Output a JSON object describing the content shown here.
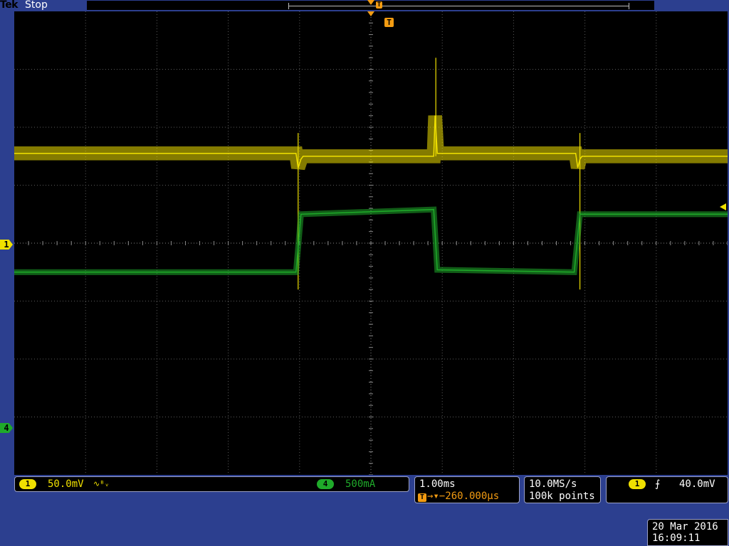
{
  "header": {
    "brand": "Tek",
    "acquisition_state": "Stop",
    "trigger_position_marker": "T"
  },
  "graticule": {
    "horizontal_divisions": 10,
    "vertical_divisions": 8,
    "grid": true
  },
  "channels": {
    "ch1": {
      "label": "1",
      "scale": "50.0mV",
      "coupling_symbol": "∿ᴮᵥ",
      "color": "#f0e000"
    },
    "ch4": {
      "label": "4",
      "scale": "500mA",
      "color": "#1faa2a"
    }
  },
  "timebase": {
    "time_per_div": "1.00ms",
    "trigger_icon": "T",
    "trigger_delay": "→▾−260.000µs"
  },
  "acquisition": {
    "sample_rate": "10.0MS/s",
    "record_length": "100k points"
  },
  "trigger": {
    "source_label": "1",
    "slope_icon": "rising-edge-icon",
    "slope_symbol": "⨍",
    "level": "40.0mV",
    "marker_color": "#f39c12"
  },
  "timestamp": {
    "date": "20 Mar 2016",
    "time": "16:09:11"
  },
  "chart_data": {
    "type": "line",
    "xlabel": "",
    "ylabel": "",
    "x_unit_per_div": "1.00ms",
    "xlim": [
      -5,
      5
    ],
    "ylim": [
      -4,
      4
    ],
    "series": [
      {
        "name": "1",
        "color": "#f0e000",
        "points": [
          [
            -5,
            1.55
          ],
          [
            -1.05,
            1.55
          ],
          [
            -1.02,
            1.3
          ],
          [
            -0.98,
            1.45
          ],
          [
            -0.95,
            1.5
          ],
          [
            0.88,
            1.5
          ],
          [
            0.9,
            2.2
          ],
          [
            0.93,
            1.55
          ],
          [
            0.95,
            1.55
          ],
          [
            2.87,
            1.55
          ],
          [
            2.9,
            1.3
          ],
          [
            2.93,
            1.45
          ],
          [
            2.96,
            1.5
          ],
          [
            5,
            1.5
          ]
        ],
        "spikes": [
          {
            "x": -1.02,
            "y_min": -0.8,
            "y_max": 1.9
          },
          {
            "x": 0.91,
            "y_min": 1.5,
            "y_max": 3.2
          },
          {
            "x": 2.93,
            "y_min": -0.8,
            "y_max": 1.9
          }
        ],
        "noise_band": 0.12
      },
      {
        "name": "4",
        "color": "#1faa2a",
        "points": [
          [
            -5,
            -0.5
          ],
          [
            -1.05,
            -0.5
          ],
          [
            -0.98,
            0.5
          ],
          [
            0.88,
            0.58
          ],
          [
            0.93,
            -0.46
          ],
          [
            2.85,
            -0.5
          ],
          [
            2.93,
            0.5
          ],
          [
            5,
            0.5
          ]
        ],
        "noise_band": 0.05
      }
    ]
  }
}
